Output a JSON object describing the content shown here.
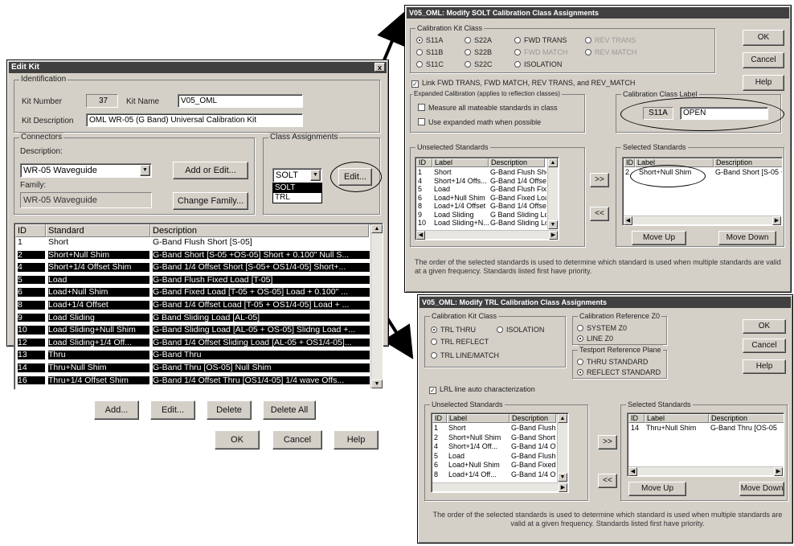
{
  "edit_kit": {
    "title": "Edit Kit",
    "close": "x",
    "identification_label": "Identification",
    "kit_number_label": "Kit Number",
    "kit_number": "37",
    "kit_name_label": "Kit Name",
    "kit_name": "V05_OML",
    "kit_description_label": "Kit Description",
    "kit_description": "OML WR-05 (G Band) Universal Calibration Kit",
    "connectors_label": "Connectors",
    "description_label": "Description:",
    "connector_description": "WR-05 Waveguide",
    "add_or_edit": "Add or Edit...",
    "family_label": "Family:",
    "family": "WR-05 Waveguide",
    "change_family": "Change Family...",
    "class_assignments_label": "Class Assignments",
    "class_selected": "SOLT",
    "class_options": [
      "SOLT",
      "TRL"
    ],
    "edit_class": "Edit...",
    "columns": [
      "ID",
      "Standard",
      "Description"
    ],
    "rows": [
      {
        "id": "1",
        "standard": "Short",
        "description": "G-Band Flush Short [S-05]"
      },
      {
        "id": "2",
        "standard": "Short+Null Shim",
        "description": "G-Band  Short [S-05 +OS-05] Short + 0.100\" Null S..."
      },
      {
        "id": "4",
        "standard": "Short+1/4 Offset Shim",
        "description": "G-Band 1/4 Offset Short [S-05+ OS1/4-05] Short+..."
      },
      {
        "id": "5",
        "standard": "Load",
        "description": "G-Band Flush Fixed Load [T-05]"
      },
      {
        "id": "6",
        "standard": "Load+Null Shim",
        "description": "G-Band Fixed Load [T-05 + OS-05] Load + 0.100\" ..."
      },
      {
        "id": "8",
        "standard": "Load+1/4 Offset",
        "description": "G-Band 1/4 Offset Load [T-05 + OS1/4-05] Load + ..."
      },
      {
        "id": "9",
        "standard": "Load Sliding",
        "description": "G Band Sliding Load [AL-05]"
      },
      {
        "id": "10",
        "standard": "Load Sliding+Null Shim",
        "description": "G-Band Sliding Load [AL-05 + OS-05] Slidng Load +..."
      },
      {
        "id": "12",
        "standard": "Load Sliding+1/4 Off...",
        "description": "G-Band 1/4 Offset Sliding Load [AL-05 + OS1/4-05]..."
      },
      {
        "id": "13",
        "standard": "Thru",
        "description": "G-Band Thru"
      },
      {
        "id": "14",
        "standard": "Thru+Null Shim",
        "description": "G-Band Thru [OS-05] Null Shim"
      },
      {
        "id": "16",
        "standard": "Thru+1/4 Offset Shim",
        "description": "G-Band 1/4 Offset Thru [OS1/4-05] 1/4 wave Offs..."
      }
    ],
    "add": "Add...",
    "edit": "Edit...",
    "delete": "Delete",
    "delete_all": "Delete All",
    "ok": "OK",
    "cancel": "Cancel",
    "help": "Help"
  },
  "solt": {
    "title": "V05_OML: Modify SOLT Calibration Class Assignments",
    "kit_class_label": "Calibration Kit Class",
    "radios": {
      "s11a": "S11A",
      "s22a": "S22A",
      "fwd_trans": "FWD TRANS",
      "rev_trans": "REV TRANS",
      "s11b": "S11B",
      "s22b": "S22B",
      "fwd_match": "FWD MATCH",
      "rev_match": "REV MATCH",
      "s11c": "S11C",
      "s22c": "S22C",
      "isolation": "ISOLATION"
    },
    "ok": "OK",
    "cancel": "Cancel",
    "help": "Help",
    "link_label": "Link FWD TRANS, FWD MATCH, REV TRANS, and REV_MATCH",
    "expanded_label": "Expanded Calibration (applies to reflection classes)",
    "measure_all": "Measure all mateable standards in class",
    "use_expanded": "Use expanded math when possible",
    "class_label_group": "Calibration Class Label",
    "class_code": "S11A",
    "class_label_value": "OPEN",
    "unselected_label": "Unselected Standards",
    "selected_label": "Selected Standards",
    "columns": [
      "ID",
      "Label",
      "Description"
    ],
    "unselected": [
      {
        "id": "1",
        "label": "Short",
        "description": "G-Band Flush Shor"
      },
      {
        "id": "4",
        "label": "Short+1/4 Offs...",
        "description": "G-Band 1/4 Offset"
      },
      {
        "id": "5",
        "label": "Load",
        "description": "G-Band Flush Fixed"
      },
      {
        "id": "6",
        "label": "Load+Null Shim",
        "description": "G-Band Fixed Load"
      },
      {
        "id": "8",
        "label": "Load+1/4 Offset",
        "description": "G-Band 1/4 Offset"
      },
      {
        "id": "9",
        "label": "Load Sliding",
        "description": "G Band Sliding Lo"
      },
      {
        "id": "10",
        "label": "Load Sliding+N...",
        "description": "G-Band Sliding Lo"
      }
    ],
    "selected": [
      {
        "id": "2",
        "label": "Short+Null Shim",
        "description": "G-Band  Short [S-05 +"
      }
    ],
    "move_right": ">>",
    "move_left": "<<",
    "move_up": "Move Up",
    "move_down": "Move Down",
    "note": "The order of the selected standards is used to determine which standard is used when multiple standards are valid at a given frequency. Standards listed first have priority."
  },
  "trl": {
    "title": "V05_OML: Modify TRL Calibration Class Assignments",
    "kit_class_label": "Calibration Kit Class",
    "radios": {
      "trl_thru": "TRL THRU",
      "isolation": "ISOLATION",
      "trl_reflect": "TRL REFLECT",
      "trl_line_match": "TRL LINE/MATCH"
    },
    "ref_z0_label": "Calibration Reference Z0",
    "system_z0": "SYSTEM Z0",
    "line_z0": "LINE Z0",
    "testport_label": "Testport Reference Plane",
    "thru_standard": "THRU STANDARD",
    "reflect_standard": "REFLECT STANDARD",
    "ok": "OK",
    "cancel": "Cancel",
    "help": "Help",
    "lrl_label": "LRL line auto characterization",
    "unselected_label": "Unselected Standards",
    "selected_label": "Selected Standards",
    "columns": [
      "ID",
      "Label",
      "Description"
    ],
    "unselected": [
      {
        "id": "1",
        "label": "Short",
        "description": "G-Band Flush Sh"
      },
      {
        "id": "2",
        "label": "Short+Null Shim",
        "description": "G-Band  Short [S"
      },
      {
        "id": "4",
        "label": "Short+1/4 Off...",
        "description": "G-Band 1/4 Offs"
      },
      {
        "id": "5",
        "label": "Load",
        "description": "G-Band Flush Fix"
      },
      {
        "id": "6",
        "label": "Load+Null Shim",
        "description": "G-Band Fixed Lo"
      },
      {
        "id": "8",
        "label": "Load+1/4 Off...",
        "description": "G-Band 1/4 Offs"
      }
    ],
    "selected": [
      {
        "id": "14",
        "label": "Thru+Null Shim",
        "description": "G-Band Thru [OS-05"
      }
    ],
    "move_right": ">>",
    "move_left": "<<",
    "move_up": "Move Up",
    "move_down": "Move Down",
    "note": "The order of the selected standards is used to determine which standard is used when multiple standards are valid at a given frequency. Standards listed first have priority."
  }
}
